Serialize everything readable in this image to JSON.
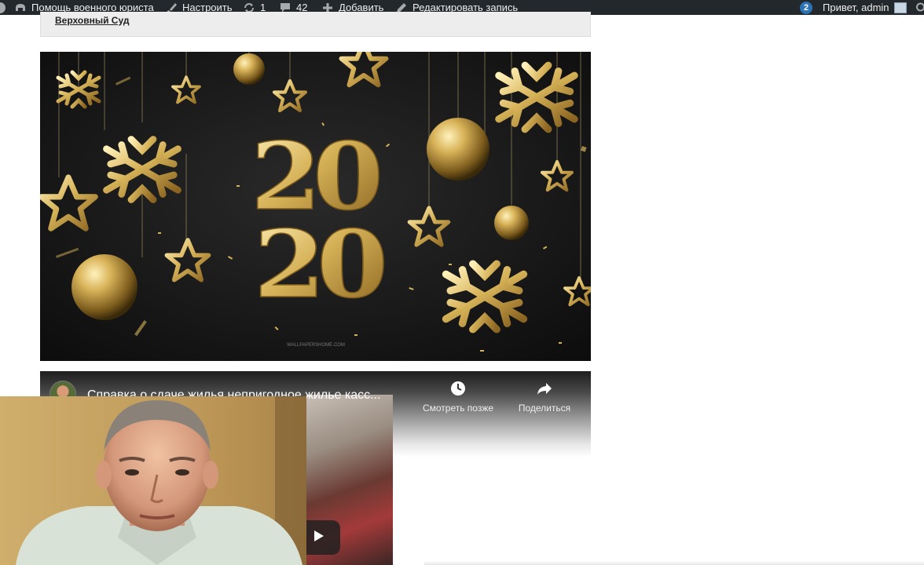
{
  "admin_bar": {
    "site_name": "Помощь военного юриста",
    "customize": "Настроить",
    "updates_count": "1",
    "comments_count": "42",
    "add_new": "Добавить",
    "edit_post": "Редактировать запись",
    "notifications_count": "2",
    "greeting": "Привет, admin"
  },
  "breadcrumb": {
    "link": "Верховный Суд"
  },
  "banner": {
    "year_top": "20",
    "year_bottom": "20",
    "watermark": "WALLPAPERSHOME.COM",
    "colors": {
      "background": "#141414",
      "gold": "#d4b25a"
    }
  },
  "video": {
    "title": "Справка о сдаче жилья непригодное жилье касс...",
    "watch_later": "Смотреть позже",
    "share": "Поделиться"
  },
  "icons": [
    "wordpress-icon",
    "site-home-icon",
    "brush-icon",
    "updates-icon",
    "comments-icon",
    "plus-icon",
    "pencil-icon",
    "clock-icon",
    "share-icon",
    "play-icon",
    "avatar-icon",
    "search-icon"
  ]
}
